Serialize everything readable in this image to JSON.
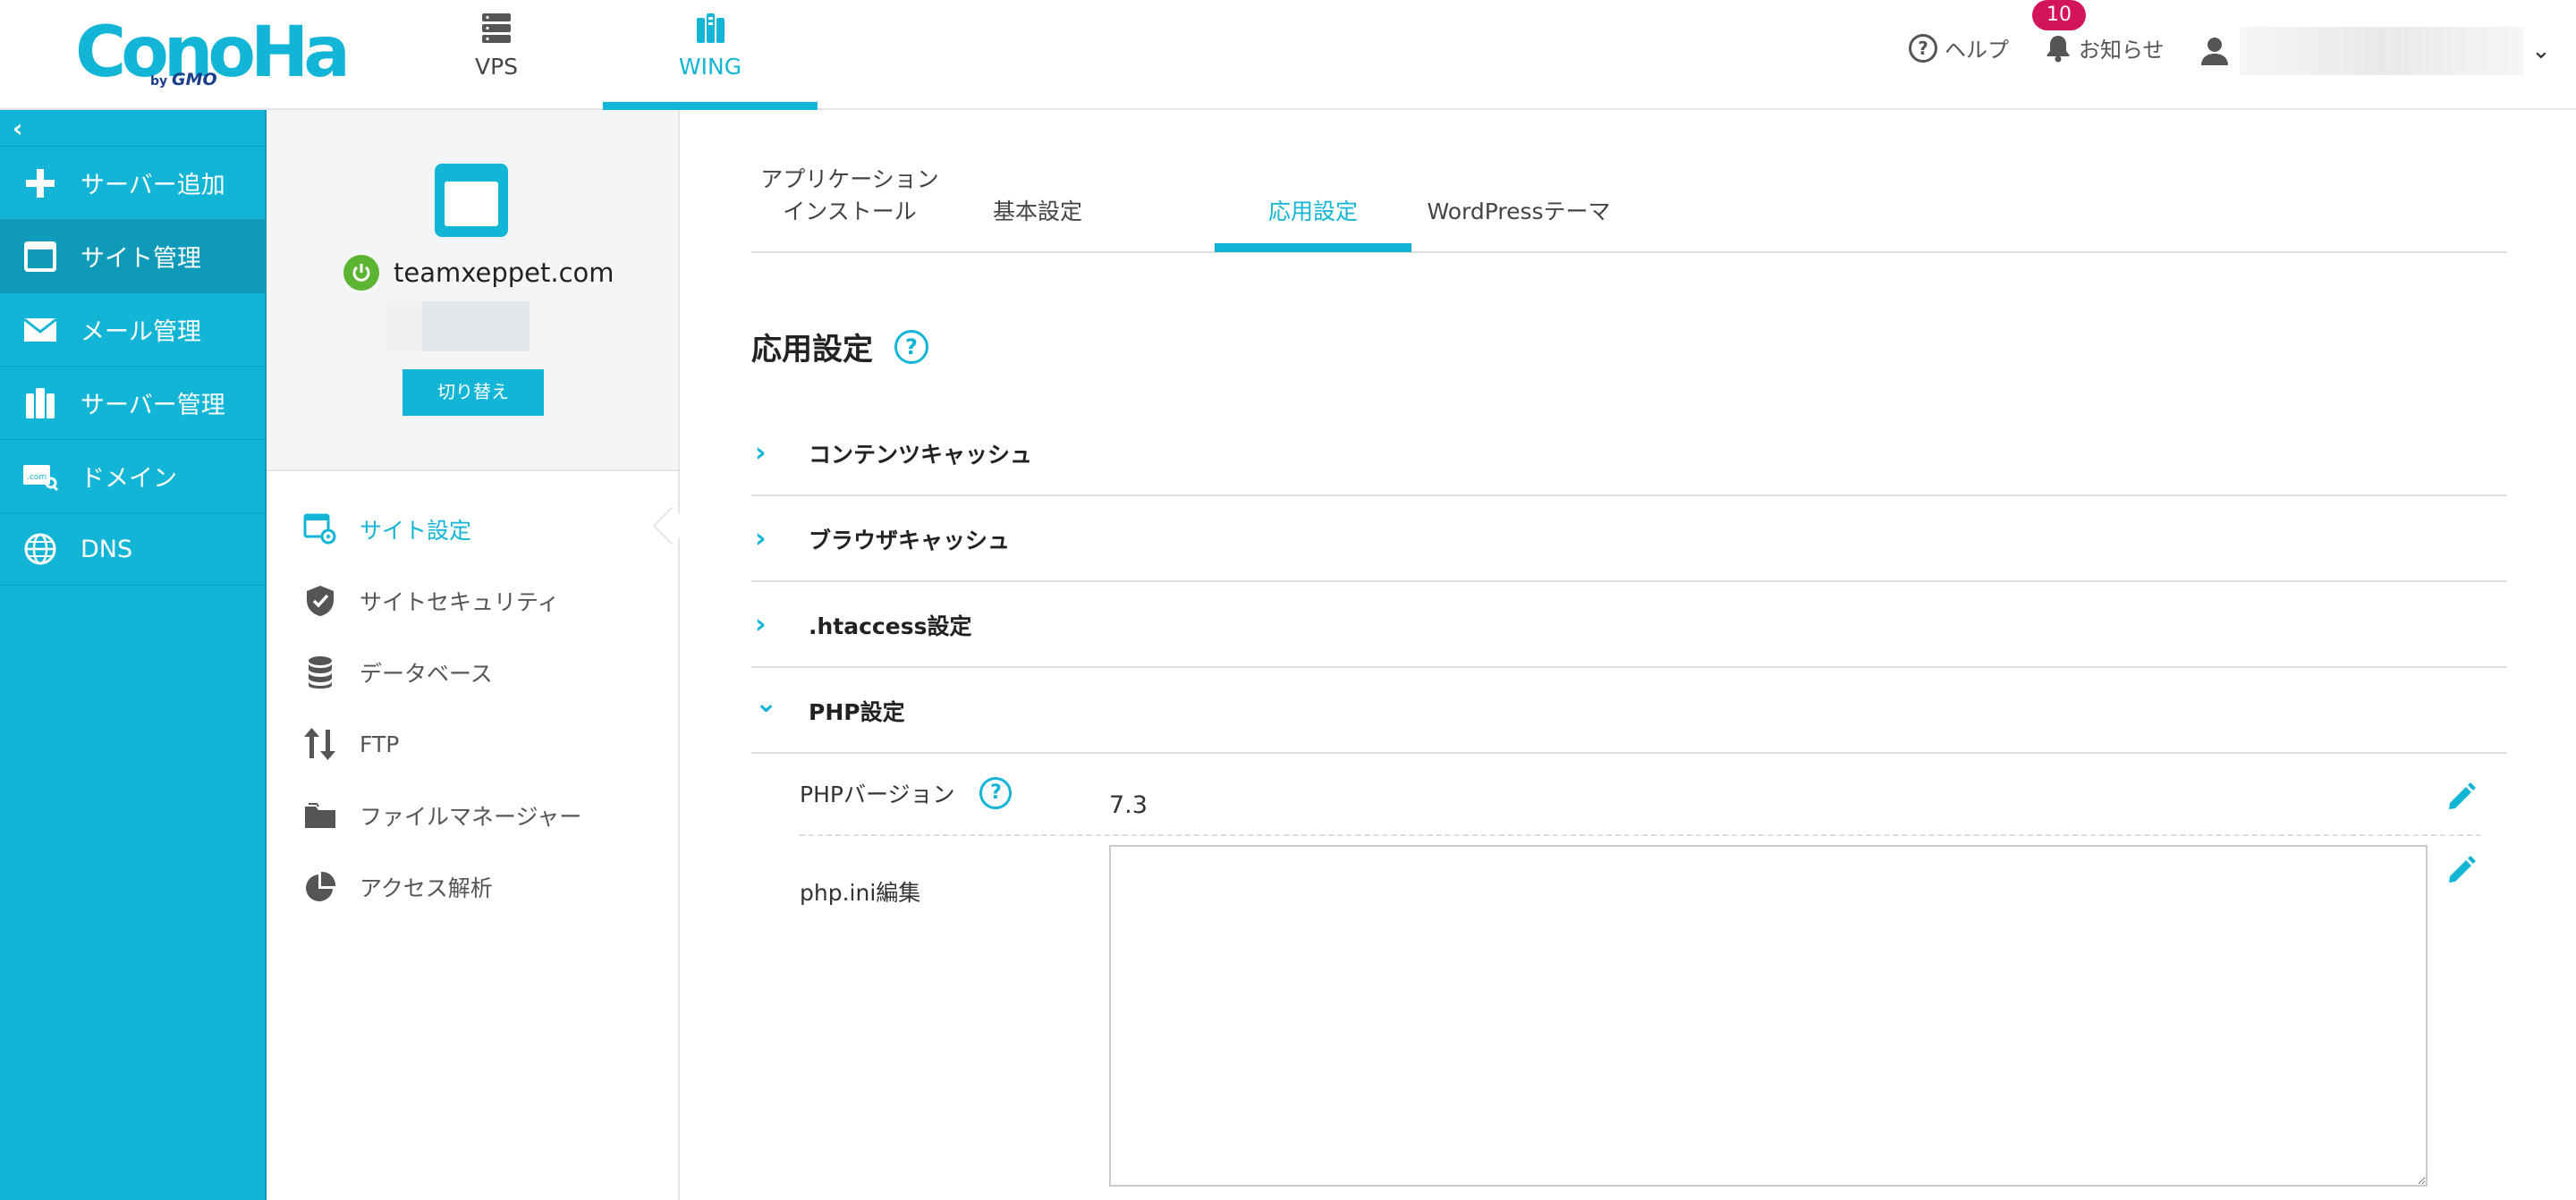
{
  "brand": {
    "logo_text": "ConoHa",
    "logo_sub_by": "by",
    "logo_sub_gmo": "GMO"
  },
  "header": {
    "nav": [
      {
        "label": "VPS",
        "icon": "server-stack-icon"
      },
      {
        "label": "WING",
        "icon": "wing-building-icon",
        "active": true
      }
    ],
    "help_label": "ヘルプ",
    "help_icon_glyph": "?",
    "notice_label": "お知らせ",
    "notice_count": "10",
    "user_caret": "⌄"
  },
  "sidebar": {
    "collapse_glyph": "‹",
    "items": [
      {
        "label": "サーバー追加",
        "icon": "plus-icon"
      },
      {
        "label": "サイト管理",
        "icon": "window-icon",
        "active": true
      },
      {
        "label": "メール管理",
        "icon": "mail-icon"
      },
      {
        "label": "サーバー管理",
        "icon": "server-icon"
      },
      {
        "label": "ドメイン",
        "icon": "domain-icon"
      },
      {
        "label": "DNS",
        "icon": "globe-icon"
      }
    ]
  },
  "site": {
    "domain": "teamxeppet.com",
    "switch_label": "切り替え"
  },
  "submenu": {
    "items": [
      {
        "label": "サイト設定",
        "icon": "site-settings-icon",
        "active": true
      },
      {
        "label": "サイトセキュリティ",
        "icon": "shield-check-icon"
      },
      {
        "label": "データベース",
        "icon": "database-icon"
      },
      {
        "label": "FTP",
        "icon": "transfer-arrows-icon"
      },
      {
        "label": "ファイルマネージャー",
        "icon": "folder-icon"
      },
      {
        "label": "アクセス解析",
        "icon": "pie-chart-icon"
      }
    ]
  },
  "tabs": {
    "app_install_line1": "アプリケーション",
    "app_install_line2": "インストール",
    "basic": "基本設定",
    "advanced": "応用設定",
    "wp_theme": "WordPressテーマ"
  },
  "section": {
    "title": "応用設定",
    "help_glyph": "?"
  },
  "accordion": [
    {
      "label": "コンテンツキャッシュ",
      "expanded": false,
      "chevron": "›"
    },
    {
      "label": "ブラウザキャッシュ",
      "expanded": false,
      "chevron": "›"
    },
    {
      "label": ".htaccess設定",
      "expanded": false,
      "chevron": "›"
    },
    {
      "label": "PHP設定",
      "expanded": true,
      "chevron": "⌄"
    }
  ],
  "php": {
    "version_label": "PHPバージョン",
    "version_value": "7.3",
    "ini_label": "php.ini編集",
    "ini_value": ""
  },
  "colors": {
    "accent": "#13b5d6",
    "sidebar_active": "#0e9ab8",
    "badge": "#d4145a",
    "power": "#5cb531"
  }
}
